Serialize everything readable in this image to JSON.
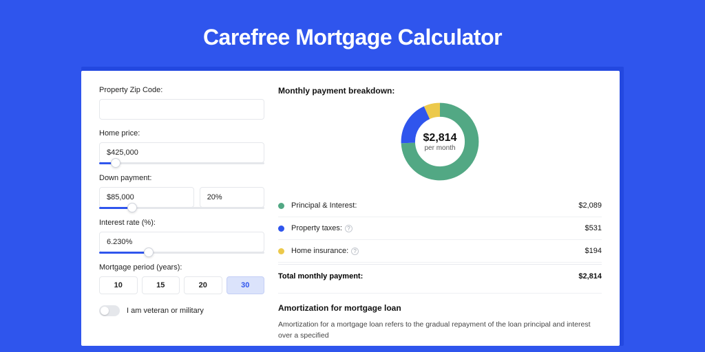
{
  "page": {
    "title": "Carefree Mortgage Calculator"
  },
  "form": {
    "zip": {
      "label": "Property Zip Code:",
      "value": ""
    },
    "home_price": {
      "label": "Home price:",
      "value": "$425,000",
      "slider_pct": 10
    },
    "down_payment": {
      "label": "Down payment:",
      "amount": "$85,000",
      "percent": "20%",
      "slider_pct": 20
    },
    "interest_rate": {
      "label": "Interest rate (%):",
      "value": "6.230%",
      "slider_pct": 30
    },
    "period": {
      "label": "Mortgage period (years):",
      "options": [
        "10",
        "15",
        "20",
        "30"
      ],
      "selected_index": 3
    },
    "veteran": {
      "label": "I am veteran or military",
      "value": false
    }
  },
  "breakdown": {
    "title": "Monthly payment breakdown:",
    "donut": {
      "center_value": "$2,814",
      "center_sub": "per month"
    },
    "items": [
      {
        "label": "Principal & Interest:",
        "value": "$2,089",
        "has_info": false
      },
      {
        "label": "Property taxes:",
        "value": "$531",
        "has_info": true
      },
      {
        "label": "Home insurance:",
        "value": "$194",
        "has_info": true
      }
    ],
    "total": {
      "label": "Total monthly payment:",
      "value": "$2,814"
    }
  },
  "amortization": {
    "title": "Amortization for mortgage loan",
    "body": "Amortization for a mortgage loan refers to the gradual repayment of the loan principal and interest over a specified"
  },
  "colors": {
    "principal": "#52a884",
    "taxes": "#2f55ed",
    "insurance": "#ecc94b"
  },
  "chart_data": {
    "type": "pie",
    "title": "Monthly payment breakdown",
    "categories": [
      "Principal & Interest",
      "Property taxes",
      "Home insurance"
    ],
    "values": [
      2089,
      531,
      194
    ],
    "total": 2814,
    "colors": [
      "#52a884",
      "#2f55ed",
      "#ecc94b"
    ]
  }
}
